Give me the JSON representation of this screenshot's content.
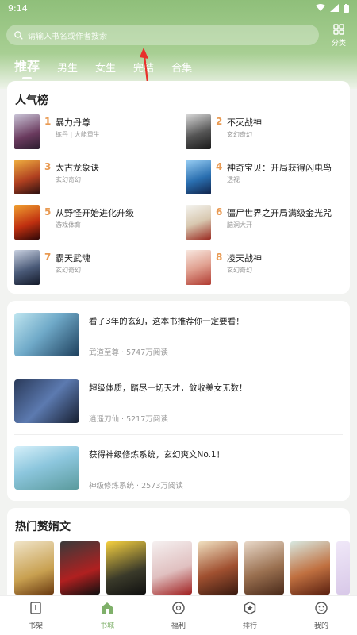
{
  "status_bar": {
    "time": "9:14"
  },
  "search": {
    "placeholder": "请输入书名或作者搜索"
  },
  "category": {
    "label": "分类"
  },
  "tabs": [
    {
      "label": "推荐",
      "active": true
    },
    {
      "label": "男生"
    },
    {
      "label": "女生"
    },
    {
      "label": "完结"
    },
    {
      "label": "合集"
    }
  ],
  "ranking": {
    "title": "人气榜",
    "items": [
      {
        "rank": "1",
        "name": "暴力丹尊",
        "tags": "练丹 | 大能重生"
      },
      {
        "rank": "2",
        "name": "不灭战神",
        "tags": "玄幻奇幻"
      },
      {
        "rank": "3",
        "name": "太古龙象诀",
        "tags": "玄幻奇幻"
      },
      {
        "rank": "4",
        "name": "神奇宝贝：开局获得闪电鸟",
        "tags": "透视"
      },
      {
        "rank": "5",
        "name": "从野怪开始进化升级",
        "tags": "游戏体育"
      },
      {
        "rank": "6",
        "name": "僵尸世界之开局满级金光咒",
        "tags": "脑洞大开"
      },
      {
        "rank": "7",
        "name": "霸天武魂",
        "tags": "玄幻奇幻"
      },
      {
        "rank": "8",
        "name": "凌天战神",
        "tags": "玄幻奇幻"
      }
    ]
  },
  "recommend": [
    {
      "title": "看了3年的玄幻，这本书推荐你一定要看！",
      "book": "武道至尊",
      "reads": "5747万阅读"
    },
    {
      "title": "超级体质，踏尽一切天才，敛收美女无数！",
      "book": "逍遥刀仙",
      "reads": "5217万阅读"
    },
    {
      "title": "获得神级修炼系统，玄幻爽文No.1！",
      "book": "神级修炼系统",
      "reads": "2573万阅读"
    }
  ],
  "hot_section": {
    "title": "热门赘婿文"
  },
  "bottom_nav": [
    {
      "label": "书架"
    },
    {
      "label": "书城",
      "active": true
    },
    {
      "label": "福利"
    },
    {
      "label": "排行"
    },
    {
      "label": "我的"
    }
  ],
  "colors": {
    "accent": "#7fb06a",
    "rank_number": "#e99a52",
    "header": "#8fbf7a"
  }
}
